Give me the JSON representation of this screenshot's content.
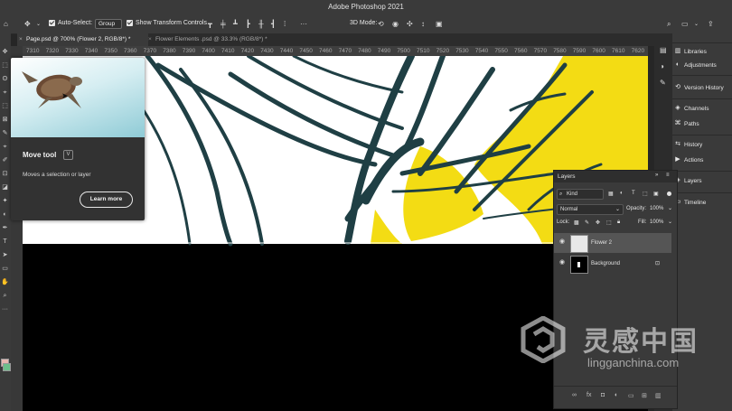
{
  "app": {
    "window_title": "Adobe Photoshop 2021"
  },
  "options_bar": {
    "auto_select_label": "Auto-Select:",
    "auto_select_value": "Group",
    "show_transform_label": "Show Transform Controls",
    "mode_3d_label": "3D Mode:"
  },
  "tabs": [
    {
      "label": "Page.psd @ 700% (Flower 2, RGB/8*) *",
      "active": true
    },
    {
      "label": "Flower Elements .psd @ 33.3% (RGB/8*) *",
      "active": false
    }
  ],
  "ruler": {
    "ticks": [
      "7310",
      "7320",
      "7330",
      "7340",
      "7350",
      "7360",
      "7370",
      "7380",
      "7390",
      "7400",
      "7410",
      "7420",
      "7430",
      "7440",
      "7450",
      "7460",
      "7470",
      "7480",
      "7490",
      "7500",
      "7510",
      "7520",
      "7530",
      "7540",
      "7550",
      "7560",
      "7570",
      "7580",
      "7590",
      "7600",
      "7610",
      "7620"
    ]
  },
  "tooltip": {
    "title": "Move tool",
    "shortcut": "V",
    "description": "Moves a selection or layer",
    "learn_more": "Learn more"
  },
  "right_panel": {
    "items": [
      "Libraries",
      "Adjustments",
      "Version History",
      "Channels",
      "Paths",
      "History",
      "Actions",
      "Layers",
      "Timeline"
    ]
  },
  "layers_panel": {
    "title": "Layers",
    "filter_kind": "Kind",
    "blend_mode": "Normal",
    "opacity_label": "Opacity:",
    "opacity_value": "100%",
    "lock_label": "Lock:",
    "fill_label": "Fill:",
    "fill_value": "100%",
    "layers": [
      {
        "name": "Flower 2",
        "selected": true
      },
      {
        "name": "Background",
        "selected": false
      }
    ]
  },
  "watermark": {
    "brand_cn": "灵感中国",
    "site": "lingganchina.com"
  },
  "colors": {
    "accent_yellow": "#f3dc14",
    "ink": "#1f3f44"
  }
}
